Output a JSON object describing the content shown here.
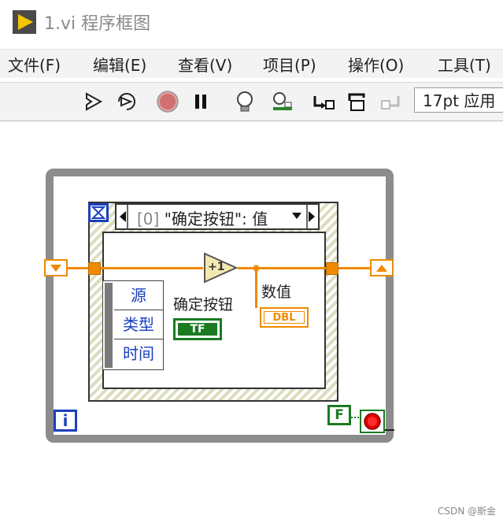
{
  "window": {
    "title": "1.vi 程序框图"
  },
  "menu": [
    "文件(F)",
    "编辑(E)",
    "查看(V)",
    "项目(P)",
    "操作(O)",
    "工具(T)"
  ],
  "toolbar": {
    "buttons": [
      "run-icon",
      "run-continuously-icon",
      "abort-icon",
      "pause-icon",
      "highlight-execution-icon",
      "retain-wire-values-icon",
      "step-into-icon",
      "step-over-icon",
      "step-out-icon"
    ],
    "font_setting": "17pt 应用"
  },
  "diagram": {
    "event_selector": {
      "index": "[0]",
      "case": "\"确定按钮\": 值"
    },
    "event_data_node": [
      "源",
      "类型",
      "时间"
    ],
    "button_label": "确定按钮",
    "button_terminal": "TF",
    "numeric_label": "数值",
    "numeric_terminal": "DBL",
    "increment": "+1",
    "iteration_terminal": "i",
    "stop_constant": "F"
  },
  "watermark": "CSDN @斯金",
  "colors": {
    "numeric": "#f08a00",
    "boolean": "#1b7a22",
    "integer": "#1a3fbf",
    "loop_border": "#8c8c8c"
  }
}
